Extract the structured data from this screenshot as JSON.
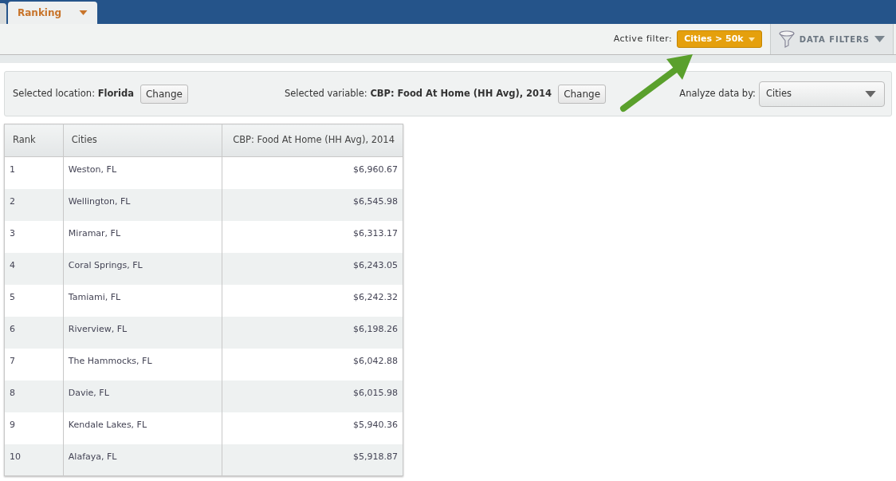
{
  "tabs": [
    {
      "label": "Ranking",
      "selected": true
    }
  ],
  "toolbar": {
    "active_filter_label": "Active filter:",
    "active_filter": "Cities > 50k",
    "data_filters": "DATA FILTERS"
  },
  "selection": {
    "location_label": "Selected location:",
    "location": "Florida",
    "location_button": "Change",
    "variable_label": "Selected variable:",
    "variable": "CBP: Food At Home (HH Avg), 2014",
    "variable_button": "Change",
    "analyze_label": "Analyze data by:",
    "analyze_value": "Cities"
  },
  "table": {
    "columns": [
      "Rank",
      "Cities",
      "CBP: Food At Home (HH Avg), 2014"
    ],
    "rows": [
      [
        "1",
        "Weston, FL",
        "$6,960.67"
      ],
      [
        "2",
        "Wellington, FL",
        "$6,545.98"
      ],
      [
        "3",
        "Miramar, FL",
        "$6,313.17"
      ],
      [
        "4",
        "Coral Springs, FL",
        "$6,243.05"
      ],
      [
        "5",
        "Tamiami, FL",
        "$6,242.32"
      ],
      [
        "6",
        "Riverview, FL",
        "$6,198.26"
      ],
      [
        "7",
        "The Hammocks, FL",
        "$6,042.88"
      ],
      [
        "8",
        "Davie, FL",
        "$6,015.98"
      ],
      [
        "9",
        "Kendale Lakes, FL",
        "$5,940.36"
      ],
      [
        "10",
        "Alafaya, FL",
        "$5,918.87"
      ]
    ]
  }
}
